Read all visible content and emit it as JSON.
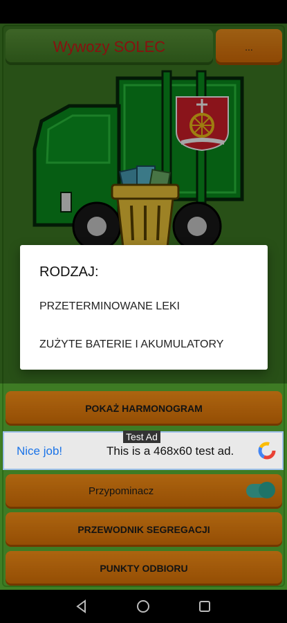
{
  "header": {
    "title": "Wywozy SOLEC",
    "menu_label": "..."
  },
  "buttons": {
    "schedule": "POKAŻ HARMONOGRAM",
    "guide": "PRZEWODNIK SEGREGACJI",
    "points": "PUNKTY ODBIORU"
  },
  "reminder": {
    "label": "Przypominacz",
    "enabled": true
  },
  "ad": {
    "tag": "Test Ad",
    "left_text": "Nice job!",
    "main_text": "This is a 468x60 test ad."
  },
  "dialog": {
    "title": "RODZAJ:",
    "items": [
      "PRZETERMINOWANE LEKI",
      "ZUŻYTE BATERIE I AKUMULATORY"
    ]
  },
  "colors": {
    "background": "#3e7b24",
    "accent_orange": "#e8830f",
    "title_red": "#d11a1a",
    "toggle_teal": "#2aa08f"
  },
  "icons": [
    "garbage-truck-illustration",
    "coat-of-arms-icon",
    "trash-bin-icon",
    "back-icon",
    "home-icon",
    "recents-icon"
  ]
}
